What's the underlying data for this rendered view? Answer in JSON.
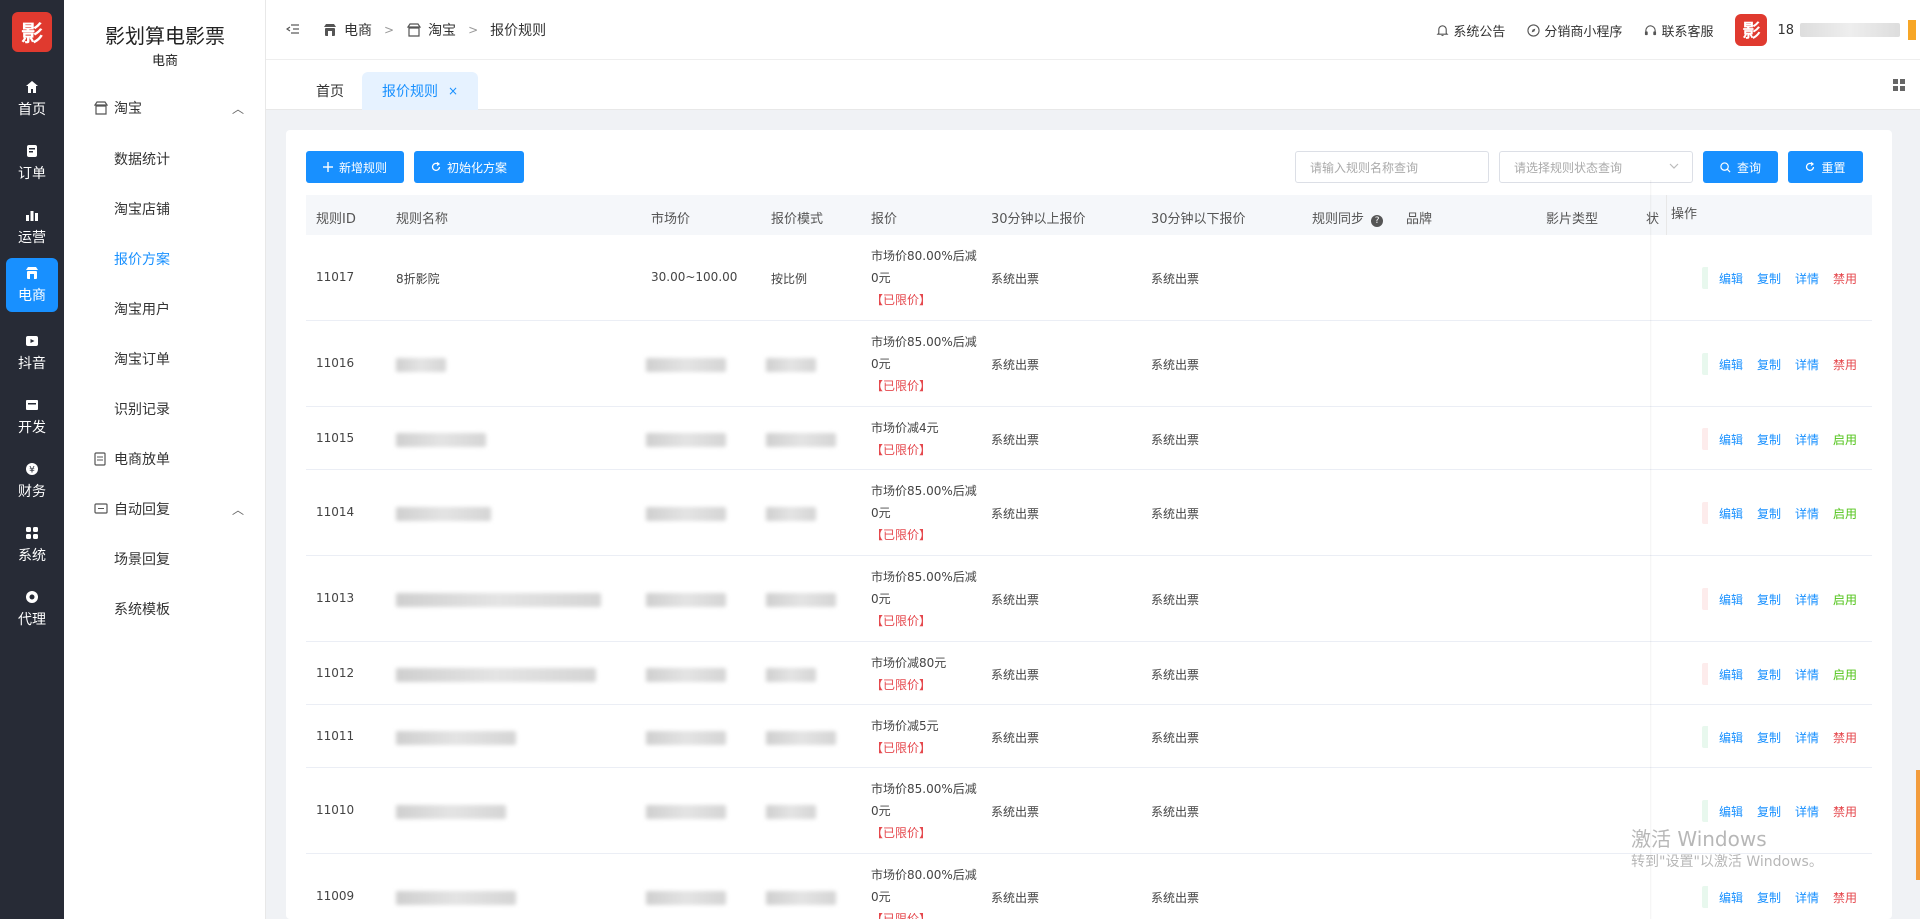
{
  "rail": {
    "logo": "影",
    "items": [
      {
        "label": "首页",
        "icon": "home-icon"
      },
      {
        "label": "订单",
        "icon": "order-icon"
      },
      {
        "label": "运营",
        "icon": "chart-icon"
      },
      {
        "label": "电商",
        "icon": "shop-icon",
        "active": true
      },
      {
        "label": "抖音",
        "icon": "video-icon"
      },
      {
        "label": "开发",
        "icon": "dev-icon"
      },
      {
        "label": "财务",
        "icon": "finance-icon"
      },
      {
        "label": "系统",
        "icon": "system-icon"
      },
      {
        "label": "代理",
        "icon": "agent-icon"
      }
    ]
  },
  "sidebar": {
    "brand_title": "影划算电影票",
    "brand_sub": "电商",
    "groups": [
      {
        "label": "淘宝",
        "items": [
          "数据统计",
          "淘宝店铺",
          "报价方案",
          "淘宝用户",
          "淘宝订单",
          "识别记录"
        ]
      },
      {
        "label": "电商放单"
      },
      {
        "label": "自动回复",
        "items": [
          "场景回复",
          "系统模板"
        ]
      }
    ],
    "active_item": "报价方案"
  },
  "header": {
    "breadcrumb": [
      "电商",
      "淘宝",
      "报价规则"
    ],
    "links": [
      "系统公告",
      "分销商小程序",
      "联系客服"
    ],
    "user_prefix": "18",
    "avatar": "影"
  },
  "tabs": [
    {
      "label": "首页"
    },
    {
      "label": "报价规则",
      "active": true,
      "close": "×"
    }
  ],
  "toolbar": {
    "add_label": "新增规则",
    "init_label": "初始化方案",
    "name_placeholder": "请输入规则名称查询",
    "status_placeholder": "请选择规则状态查询",
    "query_label": "查询",
    "reset_label": "重置"
  },
  "table": {
    "columns": [
      "规则ID",
      "规则名称",
      "市场价",
      "报价模式",
      "报价",
      "30分钟以上报价",
      "30分钟以下报价",
      "规则同步",
      "品牌",
      "影片类型",
      "状",
      "操作"
    ],
    "ops": {
      "edit": "编辑",
      "copy": "复制",
      "detail": "详情"
    },
    "rows": [
      {
        "id": "11017",
        "name": "8折影院",
        "market": "30.00~100.00",
        "mode": "按比例",
        "quote": [
          "市场价80.00%后减",
          "0元"
        ],
        "limited": "【已限价】",
        "above": "系统出票",
        "below": "系统出票",
        "toggle": "禁用",
        "toggle_color": "red"
      },
      {
        "id": "11016",
        "name": "",
        "market": "",
        "mode": "",
        "quote": [
          "市场价85.00%后减",
          "0元"
        ],
        "limited": "【已限价】",
        "above": "系统出票",
        "below": "系统出票",
        "toggle": "禁用",
        "toggle_color": "red"
      },
      {
        "id": "11015",
        "name": "",
        "market": "",
        "mode": "",
        "quote": [
          "市场价减4元"
        ],
        "limited": "【已限价】",
        "above": "系统出票",
        "below": "系统出票",
        "toggle": "启用",
        "toggle_color": "green"
      },
      {
        "id": "11014",
        "name": "",
        "market": "",
        "mode": "",
        "quote": [
          "市场价85.00%后减",
          "0元"
        ],
        "limited": "【已限价】",
        "above": "系统出票",
        "below": "系统出票",
        "toggle": "启用",
        "toggle_color": "green"
      },
      {
        "id": "11013",
        "name": "",
        "market": "",
        "mode": "",
        "quote": [
          "市场价85.00%后减",
          "0元"
        ],
        "limited": "【已限价】",
        "above": "系统出票",
        "below": "系统出票",
        "toggle": "启用",
        "toggle_color": "green"
      },
      {
        "id": "11012",
        "name": "",
        "market": "",
        "mode": "",
        "quote": [
          "市场价减80元"
        ],
        "limited": "【已限价】",
        "above": "系统出票",
        "below": "系统出票",
        "toggle": "启用",
        "toggle_color": "green"
      },
      {
        "id": "11011",
        "name": "",
        "market": "",
        "mode": "",
        "quote": [
          "市场价减5元"
        ],
        "limited": "【已限价】",
        "above": "系统出票",
        "below": "系统出票",
        "toggle": "禁用",
        "toggle_color": "red"
      },
      {
        "id": "11010",
        "name": "",
        "market": "",
        "mode": "",
        "quote": [
          "市场价85.00%后减",
          "0元"
        ],
        "limited": "【已限价】",
        "above": "系统出票",
        "below": "系统出票",
        "toggle": "禁用",
        "toggle_color": "red"
      },
      {
        "id": "11009",
        "name": "",
        "market": "",
        "mode": "",
        "quote": [
          "市场价80.00%后减",
          "0元"
        ],
        "limited": "【已限价】",
        "above": "系统出票",
        "below": "系统出票",
        "toggle": "禁用",
        "toggle_color": "red"
      }
    ]
  },
  "watermark": {
    "line1": "激活 Windows",
    "line2": "转到\"设置\"以激活 Windows。"
  },
  "colors": {
    "primary": "#1890ff",
    "rail_bg": "#272b36",
    "danger": "#e5484d",
    "success": "#52c41a",
    "brand_red": "#e03a2f"
  }
}
